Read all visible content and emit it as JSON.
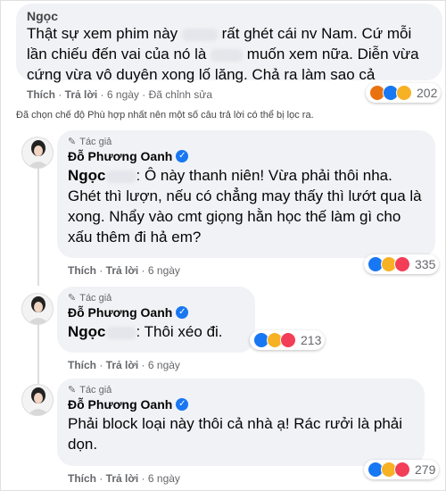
{
  "comments": [
    {
      "name": "Ngọc",
      "text1": "Thật sự xem phim này",
      "text2": "rất ghét cái nv Nam. Cứ mỗi lần chiếu đến vai của nó là",
      "text3": "muốn xem nữa. Diễn vừa cứng vừa vô duyên xong lố lăng. Chả ra làm sao cả",
      "like": "Thích",
      "reply": "Trả lời",
      "time": "6 ngày",
      "edited": "Đã chỉnh sửa",
      "reaction_count": "202",
      "reactions": [
        "angry",
        "like",
        "haha"
      ]
    },
    {
      "notice": "Đã chọn chế độ Phù hợp nhất nên một số câu trả lời có thể bị lọc ra."
    },
    {
      "author_tag": "Tác giả",
      "name": "Đỗ Phương Oanh",
      "mention": "Ngọc",
      "text1": ": Ô này thanh niên! Vừa phải thôi nha.",
      "text2": "Ghét thì lượn, nếu có chẳng may thấy thì lướt qua là xong. Nhẩy vào cmt giọng hằn học thế làm gì cho xấu thêm đi hả em?",
      "like": "Thích",
      "reply": "Trả lời",
      "time": "6 ngày",
      "reaction_count": "335",
      "reactions": [
        "like",
        "haha",
        "love"
      ]
    },
    {
      "author_tag": "Tác giả",
      "name": "Đỗ Phương Oanh",
      "mention": "Ngọc",
      "text1": ": Thôi xéo đi.",
      "like": "Thích",
      "reply": "Trả lời",
      "time": "6 ngày",
      "reaction_count": "213",
      "reactions": [
        "like",
        "haha",
        "love"
      ]
    },
    {
      "author_tag": "Tác giả",
      "name": "Đỗ Phương Oanh",
      "text1": "Phải block loại này thôi cả nhà ạ! Rác rưởi là phải dọn.",
      "like": "Thích",
      "reply": "Trả lời",
      "time": "6 ngày",
      "reaction_count": "279",
      "reactions": [
        "like",
        "haha",
        "love"
      ]
    }
  ],
  "colors": {
    "like": "#1877f2",
    "haha": "#f7b125",
    "love": "#f33e58",
    "angry": "#e9710f",
    "verified": "#1877f2"
  },
  "icons": {
    "verified": "verified-badge-icon",
    "author": "pen-icon"
  }
}
